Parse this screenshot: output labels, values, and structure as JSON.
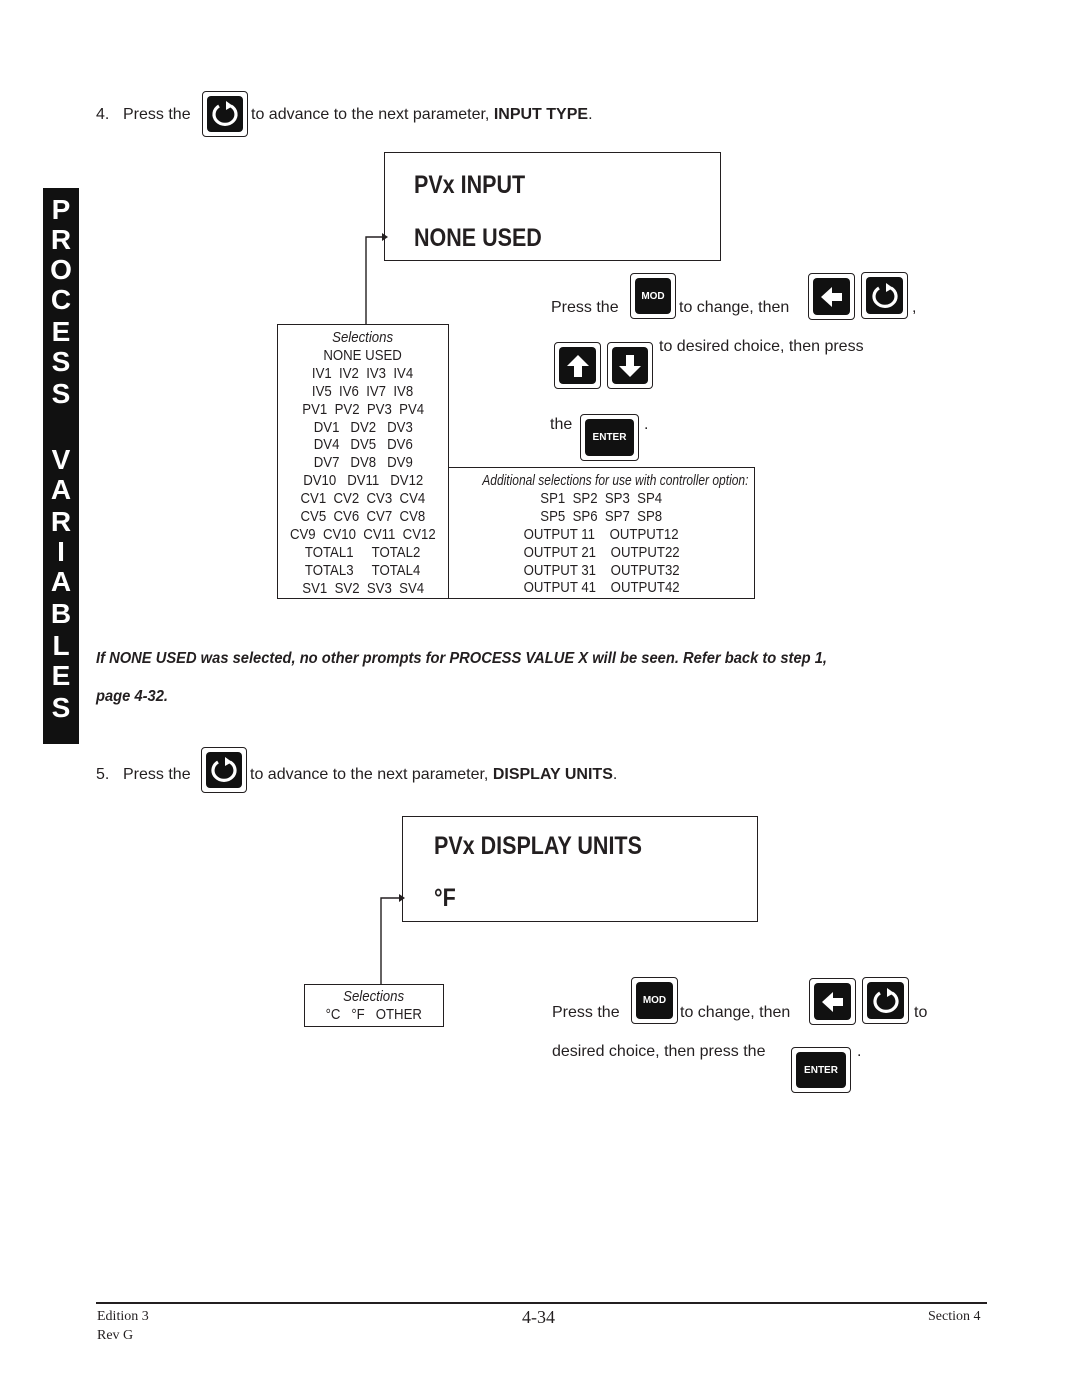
{
  "sidebar": {
    "label": "PROCESS VARIABLES",
    "letters": [
      "P",
      "R",
      "O",
      "C",
      "E",
      "S",
      "S",
      "",
      "V",
      "A",
      "R",
      "I",
      "A",
      "B",
      "L",
      "E",
      "S"
    ]
  },
  "step4": {
    "number": "4.",
    "press_the": "Press the",
    "after_key": "to advance to the next parameter,",
    "param": "INPUT TYPE",
    "period": ".",
    "key_icon": "scroll-cycle-icon"
  },
  "display1": {
    "line1": "PVx INPUT",
    "line2": "NONE USED"
  },
  "instructions1": {
    "press_the": "Press the",
    "mod_key": "MOD",
    "to_change_then": "to change, then",
    "comma": ",",
    "to_desired": "to desired choice, then press",
    "the": "the",
    "enter_key": "ENTER",
    "period": "."
  },
  "selections1": {
    "header": "Selections",
    "rows": [
      "NONE USED",
      "IV1  IV2  IV3  IV4",
      "IV5  IV6  IV7  IV8",
      "PV1  PV2  PV3  PV4",
      "DV1   DV2   DV3",
      "DV4   DV5   DV6",
      "DV7   DV8   DV9",
      "DV10   DV11   DV12",
      "CV1  CV2  CV3  CV4",
      "CV5  CV6  CV7  CV8",
      "CV9  CV10  CV11  CV12",
      "TOTAL1     TOTAL2",
      "TOTAL3     TOTAL4",
      "SV1  SV2  SV3  SV4"
    ]
  },
  "additional1": {
    "header": "Additional selections for use with controller option:",
    "rows": [
      "SP1  SP2  SP3  SP4",
      "SP5  SP6  SP7  SP8",
      "OUTPUT 11    OUTPUT12",
      "OUTPUT 21    OUTPUT22",
      "OUTPUT 31    OUTPUT32",
      "OUTPUT 41    OUTPUT42"
    ]
  },
  "note": {
    "line1": "If NONE USED was selected, no other prompts for PROCESS VALUE X will be seen.  Refer back to step 1,",
    "line2": "page 4-32."
  },
  "step5": {
    "number": "5.",
    "press_the": "Press the",
    "after_key": "to advance to the next parameter,",
    "param": "DISPLAY UNITS",
    "period": "."
  },
  "display2": {
    "line1": "PVx  DISPLAY  UNITS",
    "line2": "°F"
  },
  "selections2": {
    "header": "Selections",
    "row": "°C   °F   OTHER"
  },
  "instructions2": {
    "press_the": "Press the",
    "mod_key": "MOD",
    "to_change_then": "to change, then",
    "to": "to",
    "desired": "desired choice, then press the",
    "enter_key": "ENTER",
    "period": "."
  },
  "footer": {
    "edition": "Edition 3",
    "rev": "Rev G",
    "page": "4-34",
    "section": "Section 4"
  }
}
